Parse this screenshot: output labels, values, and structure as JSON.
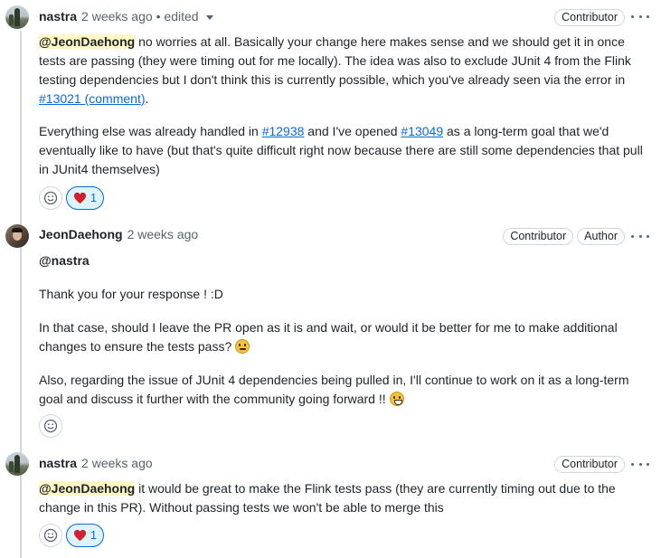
{
  "comments": [
    {
      "author": "nastra",
      "time": "2 weeks ago",
      "edited": "• edited",
      "badges": [
        "Contributor"
      ],
      "paragraphs": [
        {
          "mention": "@JeonDaehong",
          "text1": " no worries at all. Basically your change here makes sense and we should get it in once tests are passing (they were timing out for me locally). The idea was also to exclude JUnit 4 from the Flink testing dependencies but I don't think this is currently possible, which you've already seen via the error in ",
          "link1": "#13021 (comment)",
          "text2": "."
        },
        {
          "text1": "Everything else was already handled in ",
          "link1": "#12938",
          "text2": " and I've opened ",
          "link2": "#13049",
          "text3": " as a long-term goal that we'd eventually like to have (but that's quite difficult right now because there are still some dependencies that pull in JUnit4 themselves)"
        }
      ],
      "reactions": {
        "heart_count": "1"
      }
    },
    {
      "author": "JeonDaehong",
      "time": "2 weeks ago",
      "badges": [
        "Contributor",
        "Author"
      ],
      "paragraphs": [
        {
          "mention": "@nastra"
        },
        {
          "text1": "Thank you for your response ! :D"
        },
        {
          "text1": "In that case, should I leave the PR open as it is and wait, or would it be better for me to make additional changes to ensure the tests pass? ",
          "emoji": "thinking-face"
        },
        {
          "text1": "Also, regarding the issue of JUnit 4 dependencies being pulled in, I'll continue to work on it as a long-term goal and discuss it further with the community going forward !! ",
          "emoji": "grinning-face"
        }
      ]
    },
    {
      "author": "nastra",
      "time": "2 weeks ago",
      "badges": [
        "Contributor"
      ],
      "paragraphs": [
        {
          "mention": "@JeonDaehong",
          "text1": " it would be great to make the Flink tests pass (they are currently timing out due to the change in this PR). Without passing tests we won't be able to merge this"
        }
      ],
      "reactions": {
        "heart_count": "1"
      }
    }
  ],
  "icons": {
    "add_reaction": "smiley-icon",
    "heart": "heart-icon",
    "more": "kebab-horizontal-icon"
  },
  "colors": {
    "link": "#0969da",
    "mention_bg": "#fff8c5",
    "heart": "#cf222e",
    "reaction_active_bg": "#ddf4ff"
  }
}
